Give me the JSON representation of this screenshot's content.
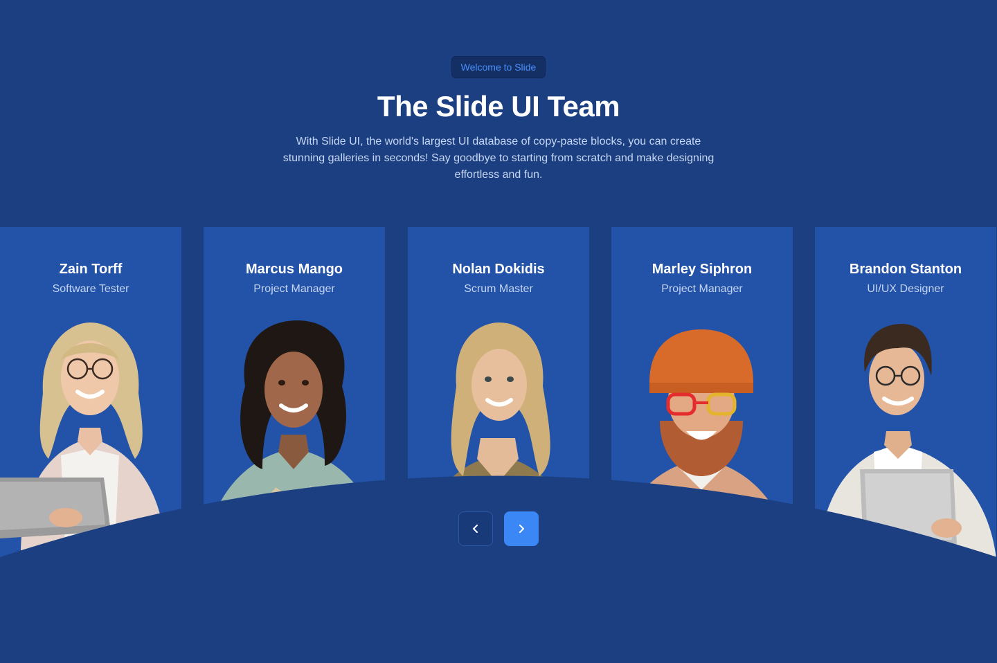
{
  "header": {
    "badge": "Welcome to Slide",
    "title": "The Slide UI Team",
    "description": "With Slide UI, the world's largest UI database of copy-paste blocks, you can create stunning galleries in seconds! Say goodbye to starting from scratch and make designing effortless and fun."
  },
  "team": [
    {
      "name": "Zain Torff",
      "role": "Software Tester"
    },
    {
      "name": "Marcus Mango",
      "role": "Project Manager"
    },
    {
      "name": "Nolan Dokidis",
      "role": "Scrum Master"
    },
    {
      "name": "Marley Siphron",
      "role": "Project Manager"
    },
    {
      "name": "Brandon Stanton",
      "role": "UI/UX Designer"
    }
  ],
  "carousel": {
    "prev_icon": "chevron-left-icon",
    "next_icon": "chevron-right-icon"
  },
  "colors": {
    "background": "#1b3f81",
    "card": "#2253a8",
    "accent": "#3b87f6",
    "badge_text": "#4a90ff"
  }
}
